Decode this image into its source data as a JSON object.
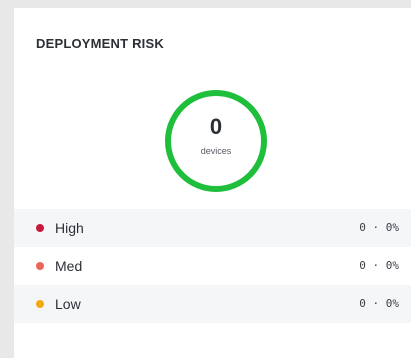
{
  "card": {
    "title": "DEPLOYMENT RISK",
    "ring": {
      "count": "0",
      "unit": "devices",
      "color": "#1fbf3c"
    },
    "rows": [
      {
        "label": "High",
        "value": "0 · 0%",
        "dot_color": "#c8193c"
      },
      {
        "label": "Med",
        "value": "0 · 0%",
        "dot_color": "#ec6458"
      },
      {
        "label": "Low",
        "value": "0 · 0%",
        "dot_color": "#f4a90f"
      }
    ]
  }
}
